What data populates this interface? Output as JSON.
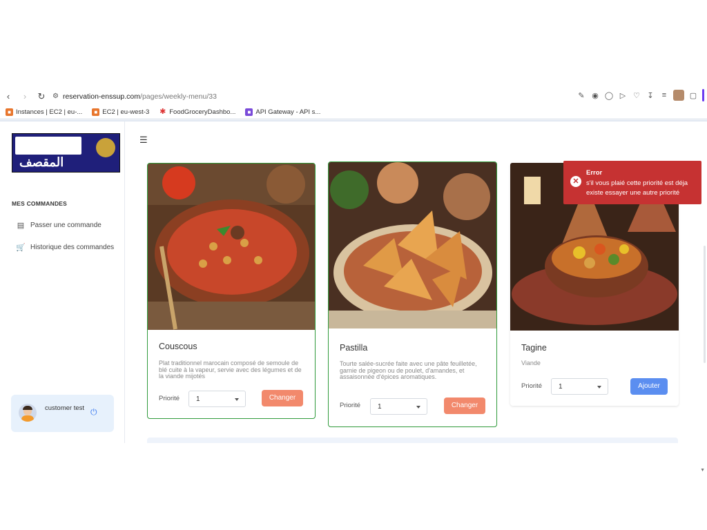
{
  "browser": {
    "url_domain": "reservation-enssup.com",
    "url_path": "/pages/weekly-menu/33",
    "bookmarks": [
      {
        "label": "Instances | EC2 | eu-..."
      },
      {
        "label": "EC2 | eu-west-3"
      },
      {
        "label": "FoodGroceryDashbo..."
      },
      {
        "label": "API Gateway - API s..."
      }
    ]
  },
  "sidebar": {
    "logo_text": "المقصف",
    "section_title": "MES COMMANDES",
    "items": [
      {
        "label": "Passer une commande",
        "icon": "order-icon"
      },
      {
        "label": "Historique des commandes",
        "icon": "cart-icon"
      }
    ],
    "user": {
      "name": "customer test"
    }
  },
  "cards": [
    {
      "title": "Couscous",
      "description": "Plat traditionnel marocain composé de semoule de blé cuite à la vapeur, servie avec des légumes et de la viande mijotés",
      "priority_label": "Priorité",
      "priority_value": "1",
      "button_label": "Changer"
    },
    {
      "title": "Pastilla",
      "description": "Tourte salée-sucrée faite avec une pâte feuilletée, garnie de pigeon ou de poulet, d'amandes, et assaisonnée d'épices aromatiques.",
      "priority_label": "Priorité",
      "priority_value": "1",
      "button_label": "Changer"
    },
    {
      "title": "Tagine",
      "description": "Viande",
      "priority_label": "Priorité",
      "priority_value": "1",
      "button_label": "Ajouter"
    }
  ],
  "toast": {
    "title": "Error",
    "message": "s'il vous plaié cette priorité est déja existe essayer une autre priorité"
  },
  "colors": {
    "selected_border": "#2f9a3a",
    "change_button": "#f2896c",
    "add_button": "#5b8ef0",
    "error_toast": "#c63232"
  }
}
